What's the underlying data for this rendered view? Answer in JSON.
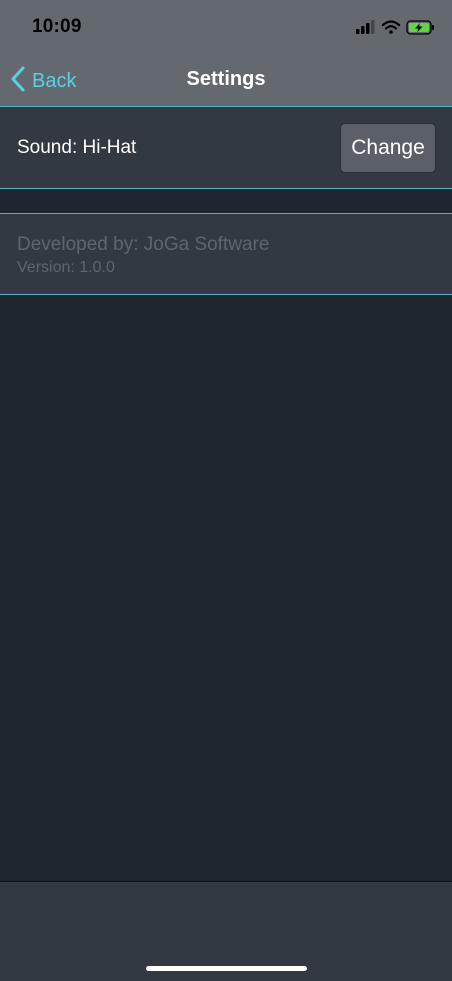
{
  "status_bar": {
    "time": "10:09"
  },
  "nav": {
    "back_label": "Back",
    "title": "Settings"
  },
  "sound": {
    "label": "Sound: Hi-Hat",
    "change_label": "Change"
  },
  "about": {
    "developer": "Developed by: JoGa Software",
    "version": "Version: 1.0.0"
  },
  "colors": {
    "accent": "#5ad0e6",
    "separator": "#57b3c2",
    "bar_background": "#646970",
    "cell_background": "#333942",
    "page_background": "#20262f",
    "muted_text": "#5f656d",
    "battery_fill": "#62d24a"
  }
}
